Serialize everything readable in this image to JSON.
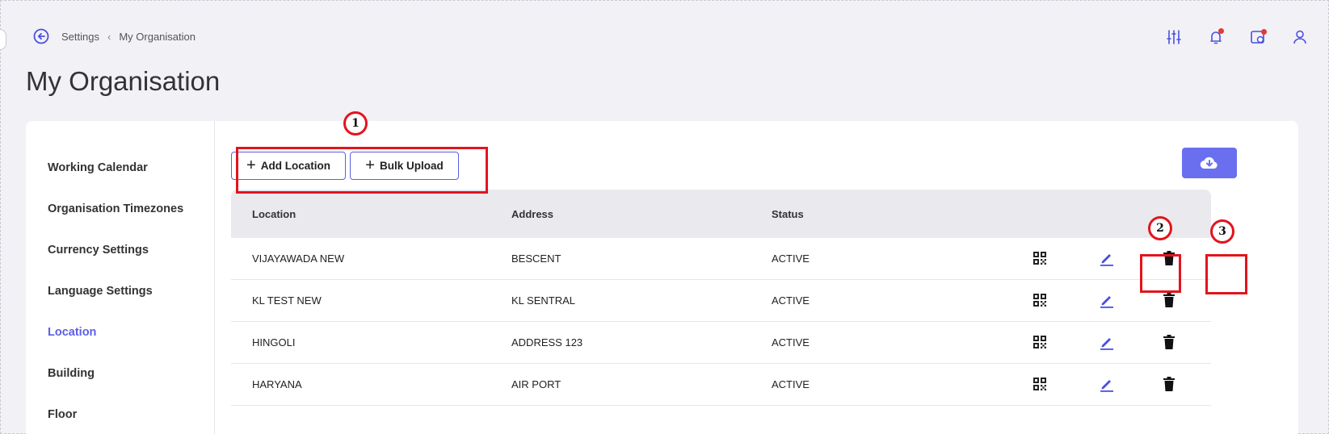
{
  "breadcrumb": {
    "root": "Settings",
    "current": "My Organisation"
  },
  "page": {
    "title": "My Organisation"
  },
  "sidebar": {
    "items": [
      {
        "label": "Working Calendar"
      },
      {
        "label": "Organisation Timezones"
      },
      {
        "label": "Currency Settings"
      },
      {
        "label": "Language Settings"
      },
      {
        "label": "Location",
        "active": true
      },
      {
        "label": "Building"
      },
      {
        "label": "Floor"
      }
    ]
  },
  "toolbar": {
    "add_location_label": "Add Location",
    "bulk_upload_label": "Bulk Upload",
    "download_icon": "cloud-download-icon"
  },
  "table": {
    "columns": [
      "Location",
      "Address",
      "Status"
    ],
    "rows": [
      {
        "location": "VIJAYAWADA NEW",
        "address": "BESCENT",
        "status": "ACTIVE"
      },
      {
        "location": "KL TEST NEW",
        "address": "KL SENTRAL",
        "status": "ACTIVE"
      },
      {
        "location": "HINGOLI",
        "address": "ADDRESS 123",
        "status": "ACTIVE"
      },
      {
        "location": "HARYANA",
        "address": "AIR PORT",
        "status": "ACTIVE"
      }
    ]
  },
  "annotations": {
    "one": "1",
    "two": "2",
    "three": "3"
  },
  "colors": {
    "accent": "#5b5fe6",
    "annotation": "#e2141d",
    "background": "#f1f1f6"
  }
}
